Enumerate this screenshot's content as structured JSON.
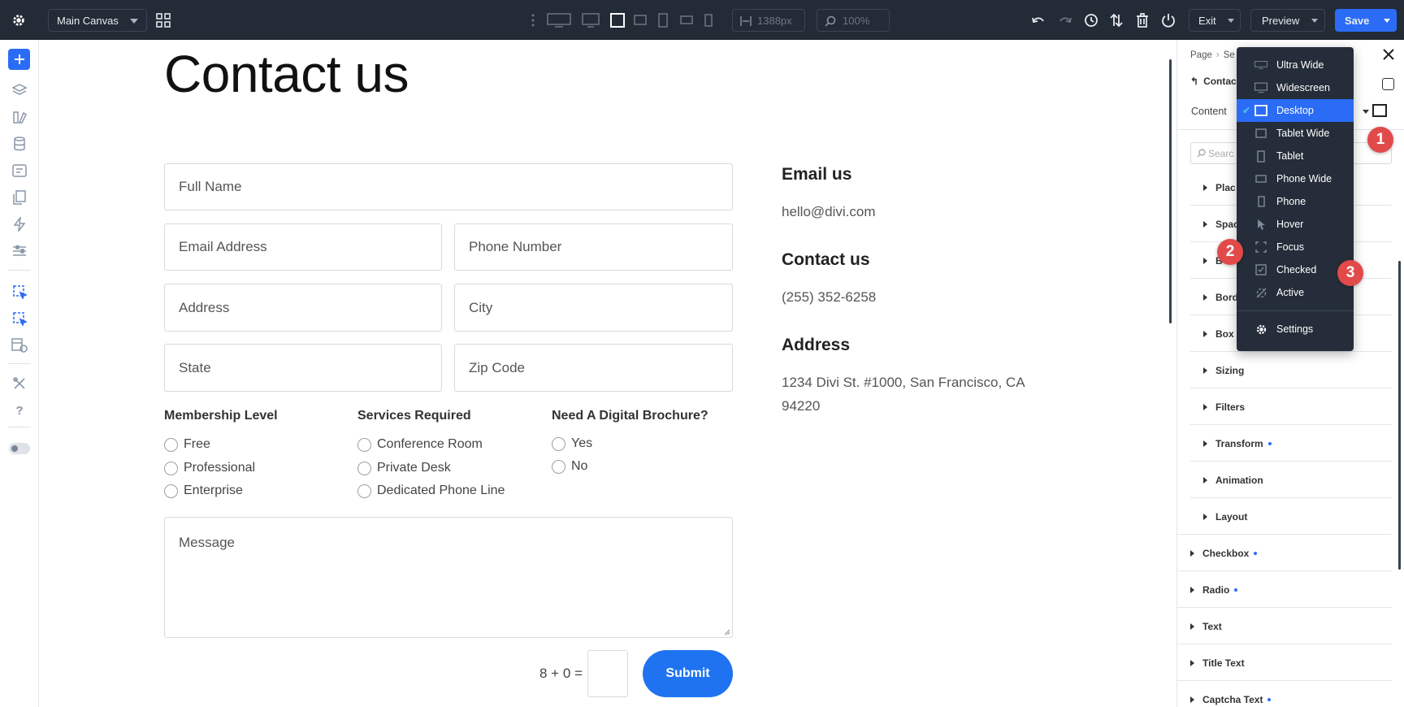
{
  "topbar": {
    "canvas_select": "Main Canvas",
    "width_value": "1388px",
    "zoom_value": "100%",
    "exit_label": "Exit",
    "preview_label": "Preview",
    "save_label": "Save"
  },
  "canvas": {
    "heading": "Contact us",
    "fields": {
      "full_name": "Full Name",
      "email": "Email Address",
      "phone": "Phone Number",
      "address": "Address",
      "city": "City",
      "state": "State",
      "zip": "Zip Code",
      "message": "Message"
    },
    "groups": [
      {
        "title": "Membership Level",
        "options": [
          "Free",
          "Professional",
          "Enterprise"
        ]
      },
      {
        "title": "Services Required",
        "options": [
          "Conference Room",
          "Private Desk",
          "Dedicated Phone Line"
        ]
      },
      {
        "title": "Need A Digital Brochure?",
        "options": [
          "Yes",
          "No"
        ]
      }
    ],
    "captcha": "8 + 0 =",
    "submit_label": "Submit",
    "info": {
      "email_heading": "Email us",
      "email_value": "hello@divi.com",
      "contact_heading": "Contact us",
      "phone_value": "(255) 352-6258",
      "address_heading": "Address",
      "address_line1": "1234 Divi St. #1000, San Francisco, CA",
      "address_line2": "94220"
    }
  },
  "panel": {
    "breadcrumb_page": "Page",
    "breadcrumb_next": "Se",
    "back_label": "Contac",
    "content_tab": "Content",
    "search_placeholder": "Searc",
    "sub_sections": [
      "Plac",
      "Spac",
      "B",
      "Bord",
      "Box",
      "Sizing",
      "Filters",
      "Transform",
      "Animation",
      "Layout"
    ],
    "sections": [
      "Checkbox",
      "Radio",
      "Text",
      "Title Text",
      "Captcha Text"
    ]
  },
  "breakpoint_menu": {
    "items": [
      "Ultra Wide",
      "Widescreen",
      "Desktop",
      "Tablet Wide",
      "Tablet",
      "Phone Wide",
      "Phone",
      "Hover",
      "Focus",
      "Checked",
      "Active"
    ],
    "icons": [
      "ultra-wide-icon",
      "widescreen-icon",
      "desktop-icon",
      "tablet-wide-icon",
      "tablet-icon",
      "phone-wide-icon",
      "phone-icon",
      "hover-icon",
      "focus-icon",
      "checked-icon",
      "active-icon"
    ],
    "selected": "Desktop",
    "settings_label": "Settings"
  },
  "callouts": [
    "1",
    "2",
    "3"
  ],
  "colors": {
    "topbar_bg": "#232b36",
    "accent": "#2b6cf6",
    "submit": "#1f73f0",
    "callout": "#e24a4a",
    "menu_bg": "#242d39",
    "checkmark": "#4fb5f0"
  }
}
